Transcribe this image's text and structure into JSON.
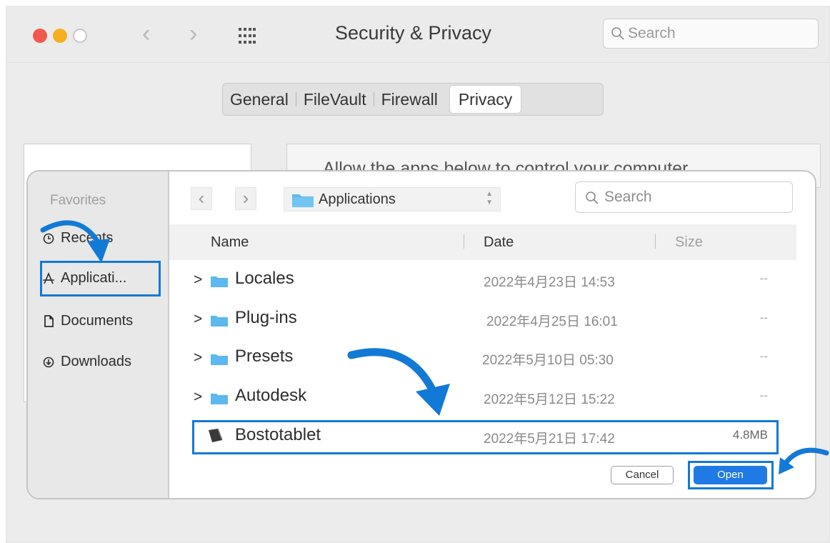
{
  "prefs_window": {
    "title": "Security & Privacy",
    "search_placeholder": "Search",
    "tabs": [
      {
        "label": "General",
        "active": false
      },
      {
        "label": "FileVault",
        "active": false
      },
      {
        "label": "Firewall",
        "active": false
      },
      {
        "label": "Privacy",
        "active": true
      }
    ],
    "partial_text": "Allow the apps below to control your computer."
  },
  "dialog": {
    "sidebar": {
      "header": "Favorites",
      "items": [
        {
          "label": "Recents",
          "icon": "clock-icon"
        },
        {
          "label": "Applicati...",
          "icon": "applications-icon",
          "selected": true
        },
        {
          "label": "Documents",
          "icon": "document-icon"
        },
        {
          "label": "Downloads",
          "icon": "download-icon"
        }
      ]
    },
    "location": "Applications",
    "search_placeholder": "Search",
    "columns": {
      "name": "Name",
      "date": "Date",
      "size": "Size"
    },
    "rows": [
      {
        "name": "Locales",
        "date": "2022年4月23日 14:53",
        "size": "--",
        "type": "folder"
      },
      {
        "name": "Plug-ins",
        "date": "2022年4月25日 16:01",
        "size": "--",
        "type": "folder"
      },
      {
        "name": "Presets",
        "date": "2022年5月10日 05:30",
        "size": "--",
        "type": "folder"
      },
      {
        "name": "Autodesk",
        "date": "2022年5月12日 15:22",
        "size": "--",
        "type": "folder"
      },
      {
        "name": "Bostotablet",
        "date": "2022年5月21日 17:42",
        "size": "4.8MB",
        "type": "app",
        "selected": true
      }
    ],
    "buttons": {
      "cancel": "Cancel",
      "open": "Open"
    }
  },
  "colors": {
    "accent": "#1f7ae6",
    "highlight_box": "#1379d6",
    "folder": "#5cb8ee"
  }
}
